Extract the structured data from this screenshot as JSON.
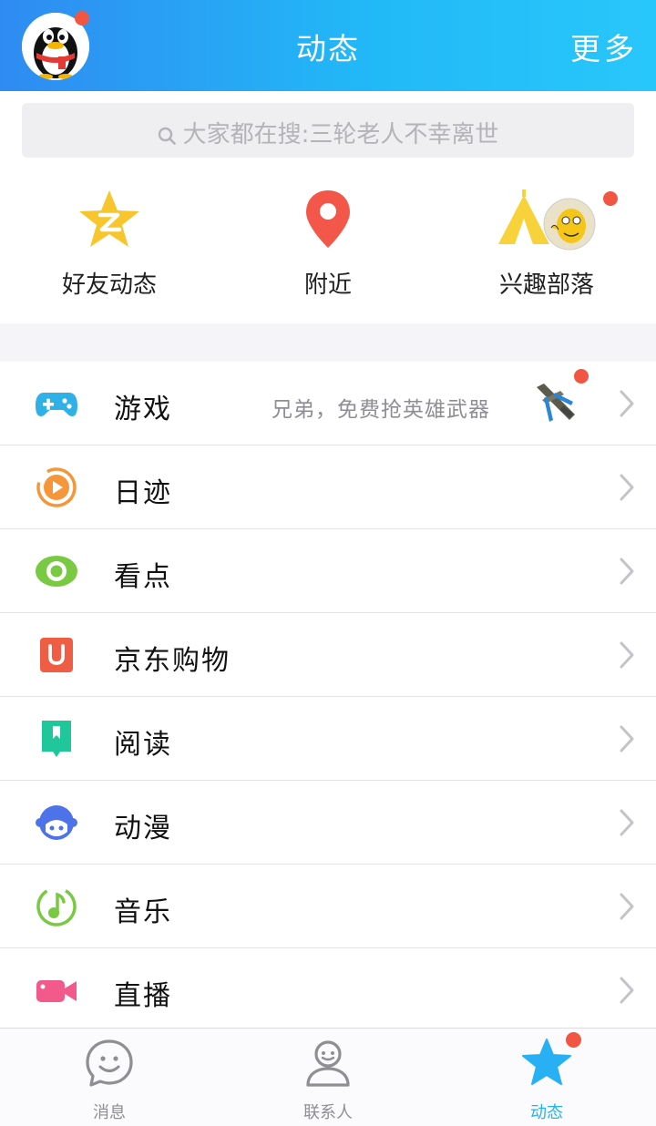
{
  "header": {
    "title": "动态",
    "more_label": "更多"
  },
  "search": {
    "text": "大家都在搜:三轮老人不幸离世"
  },
  "quick": [
    {
      "label": "好友动态",
      "icon": "qzone-star-icon"
    },
    {
      "label": "附近",
      "icon": "location-pin-icon"
    },
    {
      "label": "兴趣部落",
      "icon": "tribe-tent-icon"
    }
  ],
  "list": [
    {
      "label": "游戏",
      "icon": "gamepad-icon",
      "desc": "兄弟，免费抢英雄武器"
    },
    {
      "label": "日迹",
      "icon": "video-ring-icon"
    },
    {
      "label": "看点",
      "icon": "eye-icon"
    },
    {
      "label": "京东购物",
      "icon": "shopping-bag-icon"
    },
    {
      "label": "阅读",
      "icon": "bookmark-icon"
    },
    {
      "label": "动漫",
      "icon": "anime-face-icon"
    },
    {
      "label": "音乐",
      "icon": "music-note-icon"
    },
    {
      "label": "直播",
      "icon": "video-camera-icon"
    }
  ],
  "tabs": [
    {
      "label": "消息",
      "icon": "smile-bubble-icon",
      "active": false
    },
    {
      "label": "联系人",
      "icon": "person-icon",
      "active": false
    },
    {
      "label": "动态",
      "icon": "star-icon",
      "active": true
    }
  ],
  "colors": {
    "header_start": "#2f8bf1",
    "header_end": "#28c7fb",
    "badge": "#f25643",
    "active_tab": "#27b0f3"
  }
}
